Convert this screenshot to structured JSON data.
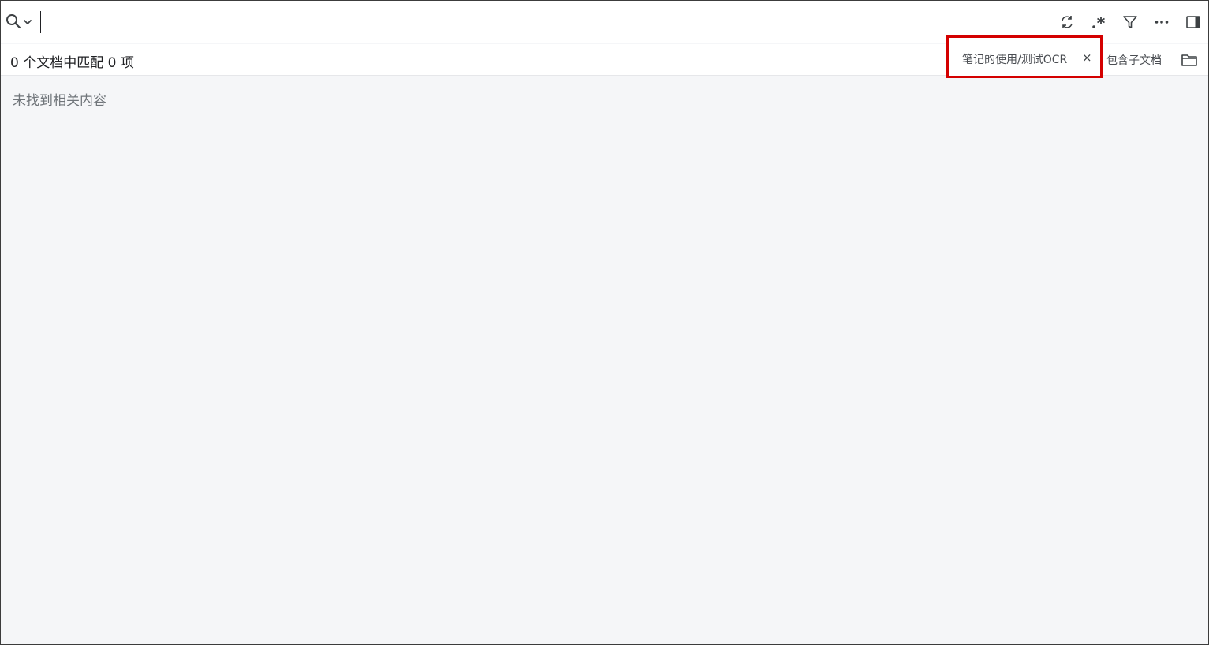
{
  "search": {
    "value": "",
    "placeholder": "",
    "icon": "search-icon"
  },
  "toolbar": {
    "icons": [
      "refresh-icon",
      "regex-icon",
      "filter-icon",
      "more-icon",
      "sidebar-toggle-icon"
    ]
  },
  "info": {
    "match_count": "0 个文档中匹配 0 项",
    "path_filter": "笔记的使用/测试OCR",
    "path_close": "×",
    "include_children": "包含子文档",
    "folder_icon": "folder-icon"
  },
  "results": {
    "empty_message": "未找到相关内容"
  },
  "colors": {
    "highlight_border": "#d40000",
    "background": "#f5f6f8",
    "text_muted": "#70757a"
  }
}
